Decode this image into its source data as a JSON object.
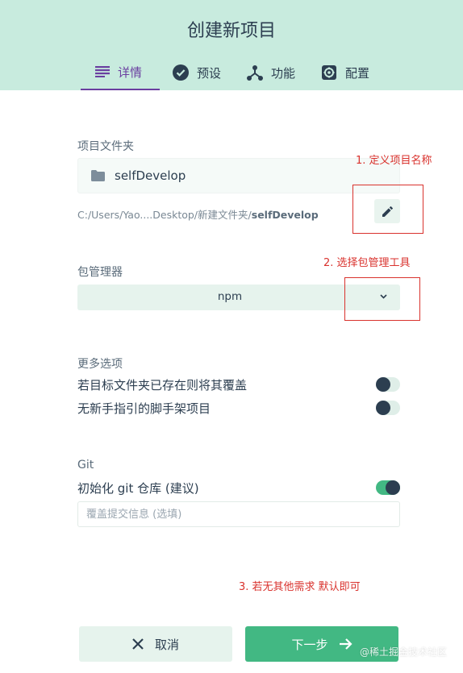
{
  "header": {
    "title": "创建新项目",
    "tabs": [
      {
        "label": "详情",
        "icon": "list-icon",
        "active": true
      },
      {
        "label": "预设",
        "icon": "check-circle-icon"
      },
      {
        "label": "功能",
        "icon": "fork-icon"
      },
      {
        "label": "配置",
        "icon": "gear-icon"
      }
    ]
  },
  "folder": {
    "label": "项目文件夹",
    "name": "selfDevelop",
    "path_prefix": "C:/Users/Yao....Desktop/新建文件夹/",
    "path_name": "selfDevelop"
  },
  "package_manager": {
    "label": "包管理器",
    "value": "npm"
  },
  "more_options": {
    "label": "更多选项",
    "items": [
      {
        "label": "若目标文件夹已存在则将其覆盖",
        "enabled": false
      },
      {
        "label": "无新手指引的脚手架项目",
        "enabled": false
      }
    ]
  },
  "git": {
    "label": "Git",
    "init_label": "初始化 git 仓库 (建议)",
    "init_enabled": true,
    "commit_placeholder": "覆盖提交信息 (选填)"
  },
  "annotations": {
    "a1": "1. 定义项目名称",
    "a2": "2. 选择包管理工具",
    "a3": "3. 若无其他需求 默认即可"
  },
  "footer": {
    "cancel_label": "取消",
    "next_label": "下一步",
    "watermark": "@稀土掘金技术社区"
  },
  "colors": {
    "header_bg": "#c8ebde",
    "accent": "#42b883",
    "active_tab": "#6a3fa0",
    "annotation": "#d9322d"
  }
}
